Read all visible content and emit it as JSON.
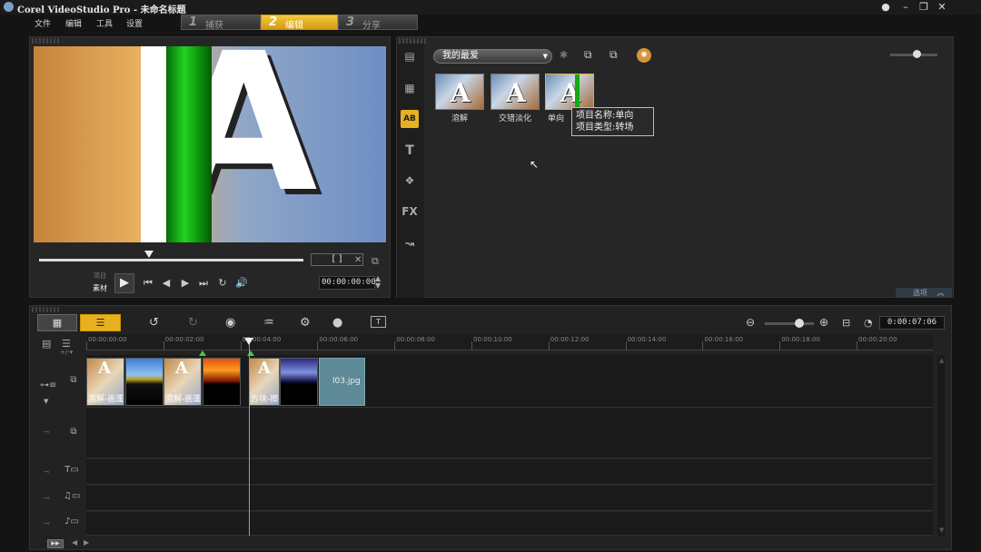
{
  "window": {
    "title": "Corel VideoStudio Pro - 未命名标题",
    "controls": [
      "restore-icon",
      "minimize-icon",
      "maximize-icon",
      "close-icon"
    ]
  },
  "menu": {
    "items": [
      "文件",
      "编辑",
      "工具",
      "设置"
    ]
  },
  "steps": [
    {
      "num": "1",
      "label": "捕获",
      "active": false
    },
    {
      "num": "2",
      "label": "编辑",
      "active": true
    },
    {
      "num": "3",
      "label": "分享",
      "active": false
    }
  ],
  "player": {
    "mode_top": "项目",
    "mode_bottom": "素材",
    "timecode": "00:00:00:00",
    "trim_bracket": "[ ]",
    "preview_letter": "A"
  },
  "library": {
    "dropdown_value": "我的最爱",
    "side_icons": [
      "media-icon",
      "instant-project-icon",
      "transition-icon",
      "title-icon",
      "graphic-icon",
      "filter-icon",
      "path-icon"
    ],
    "side_glyphs": [
      "▤",
      "▦",
      "AB",
      "T",
      "❖",
      "FX",
      "↝"
    ],
    "thumb_letter": "A",
    "items": [
      {
        "label": "溶解"
      },
      {
        "label": "交错淡化"
      },
      {
        "label": "单向"
      }
    ],
    "tooltip": {
      "line1": "项目名称:单向",
      "line2": "项目类型:转场"
    },
    "options_label": "选项"
  },
  "timeline": {
    "timecode": "0:00:07:06",
    "zoom_level": 0.7,
    "ruler": [
      "00:00:00:00",
      "00:00:02:00",
      "00:00:04:00",
      "00:00:06:00",
      "00:00:08:00",
      "00:00:10:00",
      "00:00:12:00",
      "00:00:14:00",
      "00:00:16:00",
      "00:00:18:00",
      "00:00:20:00"
    ],
    "clips": [
      {
        "label": "溶解-画蓬",
        "kind": "transition"
      },
      {
        "label": "",
        "kind": "video"
      },
      {
        "label": "溶解-画蓬",
        "kind": "transition"
      },
      {
        "label": "",
        "kind": "video"
      },
      {
        "label": "方块-擦拭",
        "kind": "transition"
      },
      {
        "label": "",
        "kind": "video"
      },
      {
        "label": "l03.jpg",
        "kind": "image"
      }
    ],
    "track_icons": [
      "video-track-icon",
      "overlay-track-icon",
      "title-track-icon",
      "voice-track-icon",
      "music-track-icon"
    ],
    "track_glyphs": [
      "⧉",
      "⧉",
      "T▭",
      "♫▭",
      "♪▭"
    ]
  },
  "colors": {
    "accent": "#e8b020",
    "active_step": "#f0c030",
    "transition_bar": "#11aa11"
  }
}
